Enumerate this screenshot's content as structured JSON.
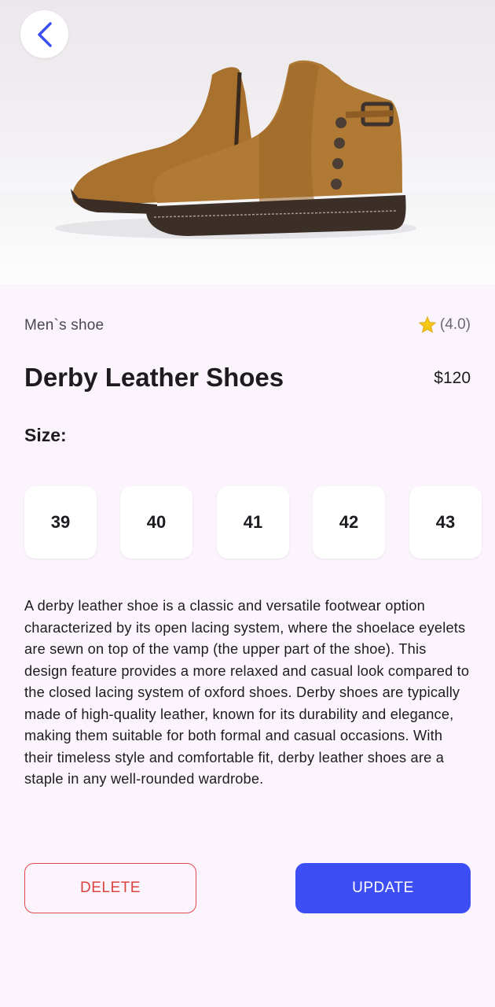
{
  "product": {
    "category": "Men`s shoe",
    "rating_text": "(4.0)",
    "title": "Derby Leather Shoes",
    "price": "$120",
    "size_label": "Size:",
    "sizes": [
      "39",
      "40",
      "41",
      "42",
      "43"
    ],
    "description": "A derby leather shoe is a classic and versatile footwear option characterized by its open lacing system, where the shoelace eyelets are sewn on top of the vamp (the upper part of the shoe). This design feature provides a more relaxed and casual look compared to the closed lacing system of oxford shoes. Derby shoes are typically made of high-quality leather, known for its durability and elegance, making them suitable for both formal and casual occasions. With their timeless style and comfortable fit, derby leather shoes are a staple in any well-rounded wardrobe."
  },
  "actions": {
    "delete_label": "DELETE",
    "update_label": "UPDATE"
  },
  "icons": {
    "back": "chevron-left-icon",
    "rating": "star-icon"
  },
  "colors": {
    "accent": "#3d4ef5",
    "danger": "#d9443f",
    "star": "#f5c518",
    "background": "#fcf4fc"
  }
}
